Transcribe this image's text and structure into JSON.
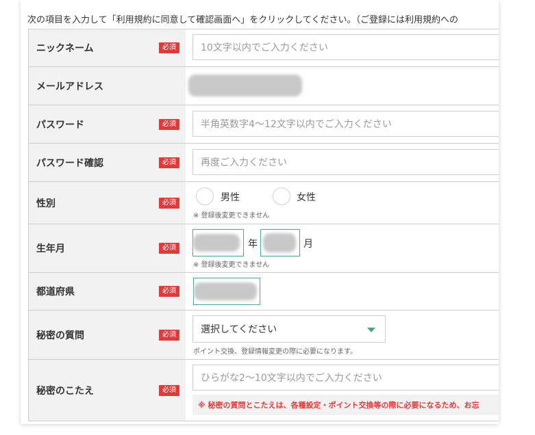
{
  "intro_text": "次の項目を入力して「利用規約に同意して確認画面へ」をクリックしてください。（ご登録には利用規約への",
  "required_badge": "必須",
  "fields": {
    "nickname": {
      "label": "ニックネーム",
      "placeholder": "10文字以内でご入力ください"
    },
    "email": {
      "label": "メールアドレス"
    },
    "password": {
      "label": "パスワード",
      "placeholder": "半角英数字4～12文字以内でご入力ください"
    },
    "password_confirm": {
      "label": "パスワード確認",
      "placeholder": "再度ご入力ください"
    },
    "gender": {
      "label": "性別",
      "options": [
        "男性",
        "女性"
      ],
      "note": "※ 登録後変更できません"
    },
    "birth": {
      "label": "生年月",
      "year_unit": "年",
      "month_unit": "月",
      "note": "※ 登録後変更できません"
    },
    "prefecture": {
      "label": "都道府県"
    },
    "secret_question": {
      "label": "秘密の質問",
      "selected": "選択してください",
      "note": "ポイント交換、登録情報変更の際に必要になります。"
    },
    "secret_answer": {
      "label": "秘密のこたえ",
      "placeholder": "ひらがな2～10文字以内でご入力ください",
      "warning": "※ 秘密の質問とこたえは、各種設定・ポイント交換等の際に必要になるため、お忘"
    }
  },
  "colors": {
    "required_badge": "#e03a3a",
    "accent": "#4aa3a3",
    "label_bg": "#f2f2f2"
  }
}
